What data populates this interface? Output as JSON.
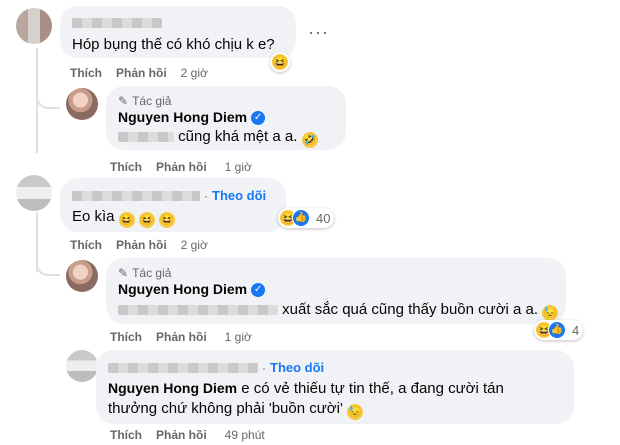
{
  "comments": [
    {
      "text": "Hóp bụng thế có khó chịu k e?",
      "actions": {
        "like": "Thích",
        "reply": "Phản hồi",
        "time": "2 giờ"
      },
      "reactions": {
        "count": ""
      }
    },
    {
      "author_badge": "Tác giả",
      "name": "Nguyen Hong Diem",
      "text": "cũng khá mệt a a.",
      "actions": {
        "like": "Thích",
        "reply": "Phản hồi",
        "time": "1 giờ"
      }
    },
    {
      "follow": "Theo dõi",
      "text": "Eo kìa",
      "actions": {
        "like": "Thích",
        "reply": "Phản hồi",
        "time": "2 giờ"
      },
      "reactions": {
        "count": "40"
      }
    },
    {
      "author_badge": "Tác giả",
      "name": "Nguyen Hong Diem",
      "text": "xuất sắc quá cũng thấy buồn cười a a.",
      "actions": {
        "like": "Thích",
        "reply": "Phản hồi",
        "time": "1 giờ"
      },
      "reactions": {
        "count": "4"
      }
    },
    {
      "follow": "Theo dõi",
      "mention": "Nguyen Hong Diem",
      "text_line1": "e có vẻ thiếu tự tin thế, a đang cười tán",
      "text_line2": "thưởng chứ không phải 'buồn cười'",
      "actions": {
        "like": "Thích",
        "reply": "Phản hồi",
        "time": "49 phút"
      }
    }
  ],
  "icons": {
    "more": "more-dots-icon",
    "verified": "verified-check-icon",
    "pen": "pen-icon",
    "haha": "haha-emoji-icon",
    "like": "like-thumb-icon"
  },
  "colors": {
    "accent": "#1877f2",
    "bubble": "#f0f2f5",
    "muted": "#65676b"
  }
}
